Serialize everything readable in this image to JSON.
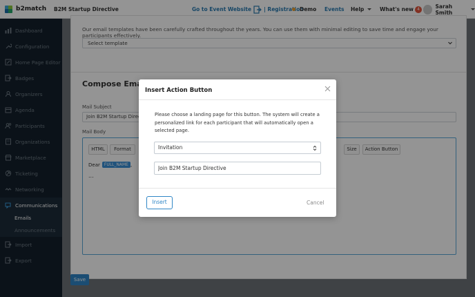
{
  "brand": {
    "name": "b2match"
  },
  "header": {
    "event_name": "B2M Startup Directive",
    "go_to_event": "Go to Event Website",
    "registration": "| Registration",
    "demo": "Demo",
    "events": "Events",
    "help": "Help",
    "whats_new": "What's new",
    "whats_new_count": "4",
    "user_name": "Sarah Smith"
  },
  "sidebar": {
    "items": [
      {
        "label": "Dashboard",
        "icon": "dashboard-icon"
      },
      {
        "label": "Configuration",
        "icon": "wrench-icon"
      },
      {
        "label": "Home Page Editor",
        "icon": "edit-icon"
      },
      {
        "label": "Badges",
        "icon": "badge-icon"
      },
      {
        "label": "Organizers",
        "icon": "organizers-icon"
      },
      {
        "label": "Agenda",
        "icon": "calendar-icon"
      },
      {
        "label": "Participants",
        "icon": "participants-icon"
      },
      {
        "label": "Organizations",
        "icon": "organizations-icon"
      },
      {
        "label": "Marketplace",
        "icon": "marketplace-icon"
      },
      {
        "label": "Ticketing",
        "icon": "ticket-icon"
      },
      {
        "label": "Networking",
        "icon": "networking-icon"
      },
      {
        "label": "Communications",
        "icon": "communications-icon"
      },
      {
        "label": "Import",
        "icon": "import-icon"
      },
      {
        "label": "Export",
        "icon": "export-icon"
      }
    ],
    "sub_items": [
      "Emails",
      "Announcements"
    ]
  },
  "main": {
    "intro_text": "Our email templates have been carefully crafted throughout the years. You can use them with minimal editing to save time and engage your participants effectively.",
    "select_template": "Select template",
    "compose_title": "Compose Email",
    "subject_label": "Mail Subject",
    "subject_value": "Join B2M Startup Directive",
    "body_label": "Mail Body",
    "toolbar": {
      "html": "HTML",
      "format": "Format",
      "size": "Size",
      "action_button": "Action Button"
    },
    "dear": "Dear",
    "placeholder": "FULL_NAME",
    "comma": ",",
    "ellipsis": "...",
    "save": "Save"
  },
  "modal": {
    "title": "Insert Action Button",
    "description": "Please choose a landing page for this button. The system will create a personalized link for each participant that will automatically open a selected page.",
    "landing_page": "Invitation",
    "button_text": "Join B2M Startup Directive",
    "insert": "Insert",
    "cancel": "Cancel"
  },
  "colors": {
    "accent": "#2f86c6",
    "sidebar_bg": "#14202b",
    "sidebar_active": "#1d2c3a",
    "badge": "#e0533b",
    "demo_dot": "#f0a030"
  }
}
